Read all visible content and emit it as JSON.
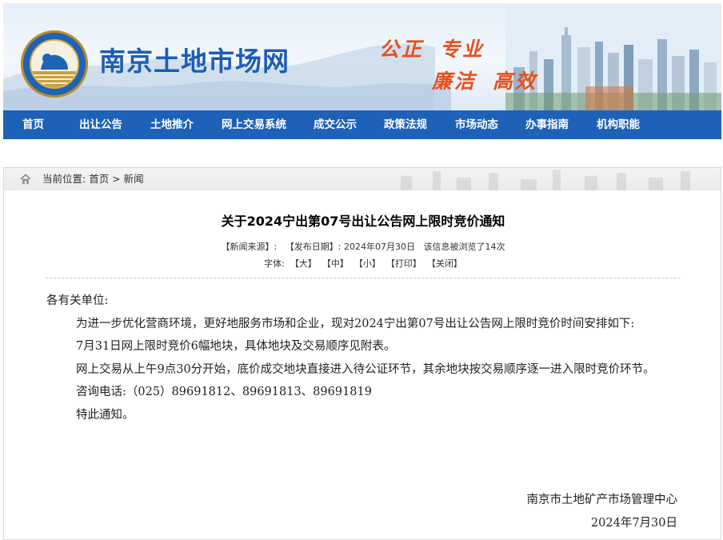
{
  "header": {
    "site_title": "南京土地市场网",
    "slogans": [
      "公正",
      "专业",
      "廉洁",
      "高效"
    ],
    "colors": {
      "title": "#1c5db5",
      "slogan": "#e6501c",
      "nav": "#1e61b8"
    }
  },
  "nav": {
    "items": [
      "首页",
      "出让公告",
      "土地推介",
      "网上交易系统",
      "成交公示",
      "政策法规",
      "市场动态",
      "办事指南",
      "机构职能"
    ]
  },
  "breadcrumb": {
    "label": "当前位置:",
    "path": "首页 > 新闻"
  },
  "article": {
    "title": "关于2024宁出第07号出让公告网上限时竞价通知",
    "meta": {
      "source": "【新闻来源】:",
      "date_label": "【发布日期】:",
      "date": "2024年07月30日",
      "views": "该信息被浏览了14次"
    },
    "font_label": "字体:",
    "font_sizes": [
      "【大】",
      "【中】",
      "【小】"
    ],
    "print": "【打印】",
    "close": "【关闭】",
    "greeting": "各有关单位:",
    "paragraphs": [
      "为进一步优化营商环境，更好地服务市场和企业，现对2024宁出第07号出让公告网上限时竞价时间安排如下:",
      "7月31日网上限时竞价6幅地块，具体地块及交易顺序见附表。",
      "网上交易从上午9点30分开始，底价成交地块直接进入待公证环节，其余地块按交易顺序逐一进入限时竞价环节。",
      "咨询电话:（025）89691812、89691813、89691819",
      "特此通知。"
    ],
    "signature": "南京市土地矿产市场管理中心",
    "sign_date": "2024年7月30日"
  }
}
